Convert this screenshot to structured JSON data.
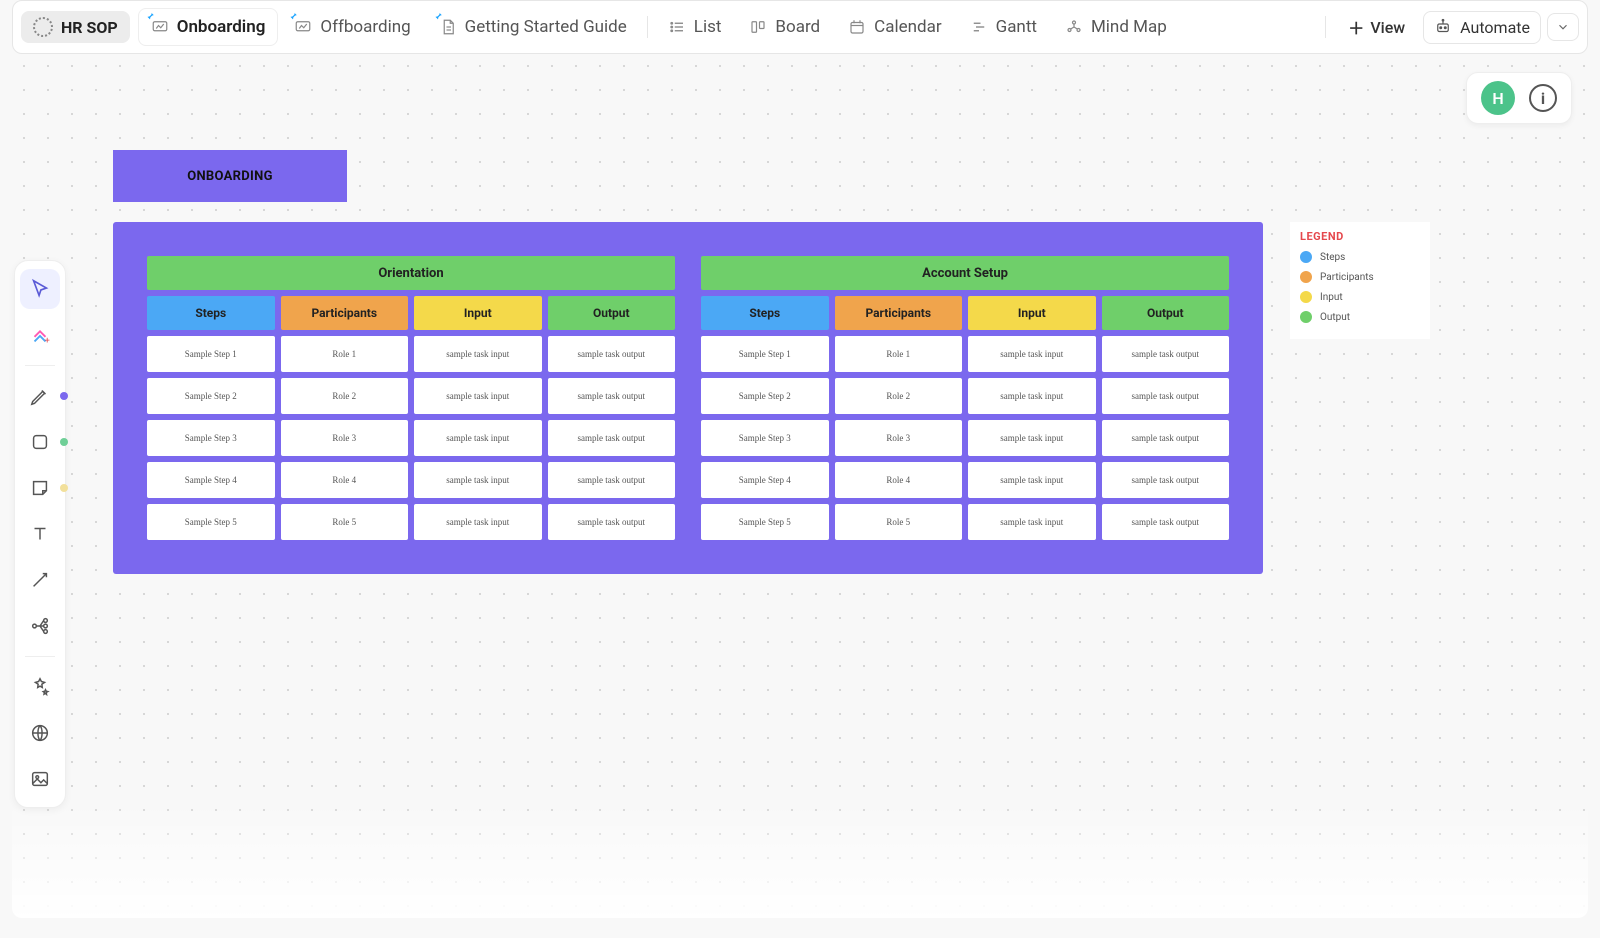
{
  "header": {
    "space_name": "HR SOP",
    "tabs": [
      {
        "label": "Onboarding",
        "icon": "whiteboard",
        "pinned": true,
        "active": true
      },
      {
        "label": "Offboarding",
        "icon": "whiteboard",
        "pinned": true,
        "active": false
      },
      {
        "label": "Getting Started Guide",
        "icon": "doc",
        "pinned": true,
        "active": false
      },
      {
        "label": "List",
        "icon": "list",
        "pinned": false,
        "active": false
      },
      {
        "label": "Board",
        "icon": "board",
        "pinned": false,
        "active": false
      },
      {
        "label": "Calendar",
        "icon": "calendar",
        "pinned": false,
        "active": false
      },
      {
        "label": "Gantt",
        "icon": "gantt",
        "pinned": false,
        "active": false
      },
      {
        "label": "Mind Map",
        "icon": "mindmap",
        "pinned": false,
        "active": false
      }
    ],
    "add_view_label": "View",
    "automate_label": "Automate"
  },
  "top_right": {
    "avatar_initial": "H"
  },
  "toolbar": {
    "tools": [
      "select",
      "upgrade",
      "pen",
      "shape",
      "sticky",
      "text",
      "connector",
      "mindmap",
      "ai",
      "web",
      "image"
    ]
  },
  "whiteboard": {
    "title_card": "ONBOARDING",
    "groups": [
      {
        "title": "Orientation",
        "columns": [
          "Steps",
          "Participants",
          "Input",
          "Output"
        ],
        "rows": [
          [
            "Sample Step 1",
            "Role 1",
            "sample task input",
            "sample task output"
          ],
          [
            "Sample Step 2",
            "Role 2",
            "sample task input",
            "sample task output"
          ],
          [
            "Sample Step 3",
            "Role 3",
            "sample task input",
            "sample task output"
          ],
          [
            "Sample Step 4",
            "Role 4",
            "sample task input",
            "sample task output"
          ],
          [
            "Sample Step 5",
            "Role 5",
            "sample task input",
            "sample task output"
          ]
        ]
      },
      {
        "title": "Account Setup",
        "columns": [
          "Steps",
          "Participants",
          "Input",
          "Output"
        ],
        "rows": [
          [
            "Sample Step 1",
            "Role 1",
            "sample task input",
            "sample task output"
          ],
          [
            "Sample Step 2",
            "Role 2",
            "sample task input",
            "sample task output"
          ],
          [
            "Sample Step 3",
            "Role 3",
            "sample task input",
            "sample task output"
          ],
          [
            "Sample Step 4",
            "Role 4",
            "sample task input",
            "sample task output"
          ],
          [
            "Sample Step 5",
            "Role 5",
            "sample task input",
            "sample task output"
          ]
        ]
      }
    ],
    "legend": {
      "title": "LEGEND",
      "items": [
        {
          "label": "Steps",
          "swatch": "steps"
        },
        {
          "label": "Participants",
          "swatch": "participants"
        },
        {
          "label": "Input",
          "swatch": "input"
        },
        {
          "label": "Output",
          "swatch": "output"
        }
      ]
    }
  }
}
